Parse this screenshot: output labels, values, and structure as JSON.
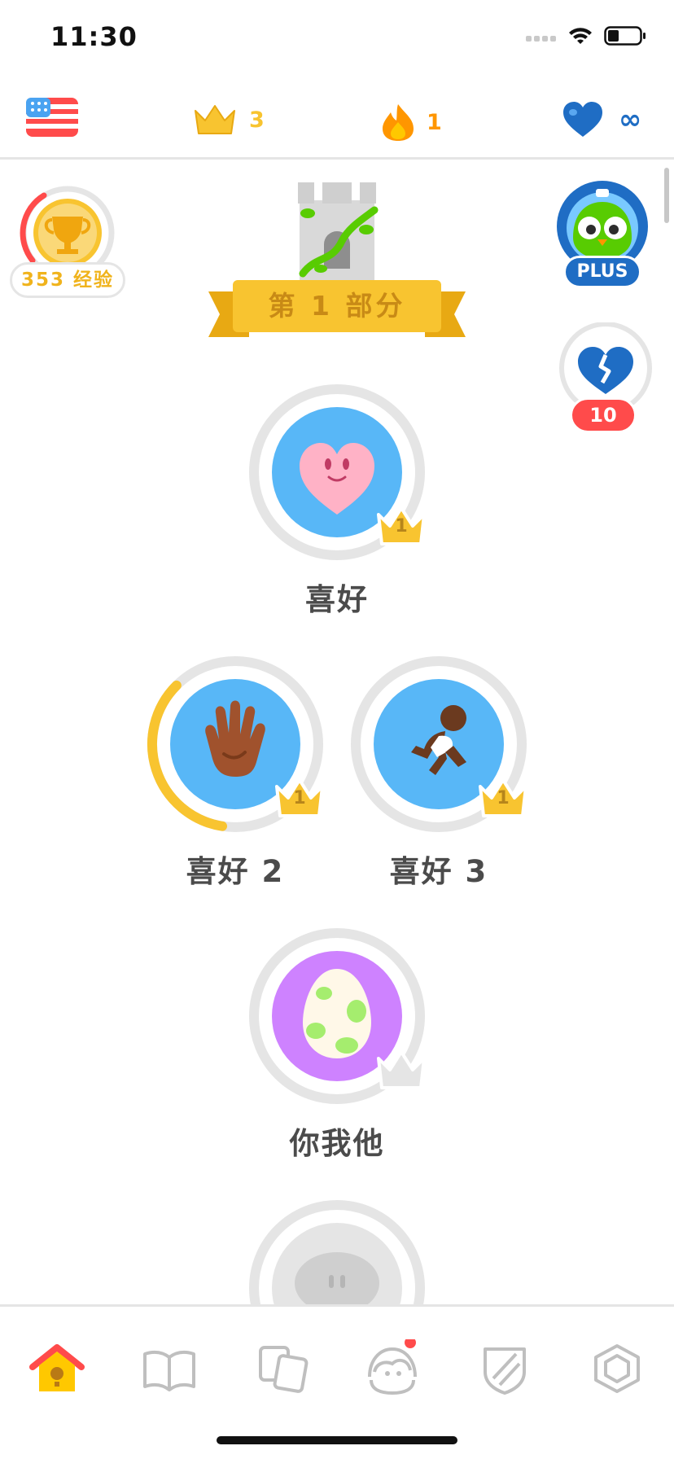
{
  "status_bar": {
    "time": "11:30"
  },
  "header": {
    "flag_icon": "us-flag-icon",
    "crowns": "3",
    "streak": "1",
    "hearts": "∞",
    "colors": {
      "crown": "#f8c430",
      "streak": "#ff9600",
      "heart": "#1f6dc4"
    }
  },
  "xp": {
    "label": "353 经验"
  },
  "plus": {
    "label": "PLUS"
  },
  "broken_hearts": {
    "count": "10"
  },
  "section": {
    "title": "第 1 部分"
  },
  "skills": [
    {
      "name": "喜好",
      "crown_level": "1",
      "icon": "heart-face-icon",
      "progress": 0.0,
      "color": "#58b7f7"
    },
    {
      "name": "喜好 2",
      "crown_level": "1",
      "icon": "hand-icon",
      "progress": 0.35,
      "color": "#58b7f7"
    },
    {
      "name": "喜好 3",
      "crown_level": "1",
      "icon": "runner-icon",
      "progress": 0.0,
      "color": "#58b7f7"
    },
    {
      "name": "你我他",
      "crown_level": "",
      "icon": "egg-icon",
      "progress": 0.0,
      "color": "#ce82ff"
    },
    {
      "name": "",
      "crown_level": "",
      "icon": "locked-skill-icon",
      "progress": 0.0,
      "color": "#e5e5e5"
    }
  ],
  "nav": [
    "home-icon",
    "book-icon",
    "cards-icon",
    "profile-icon",
    "shield-icon",
    "gem-icon"
  ]
}
